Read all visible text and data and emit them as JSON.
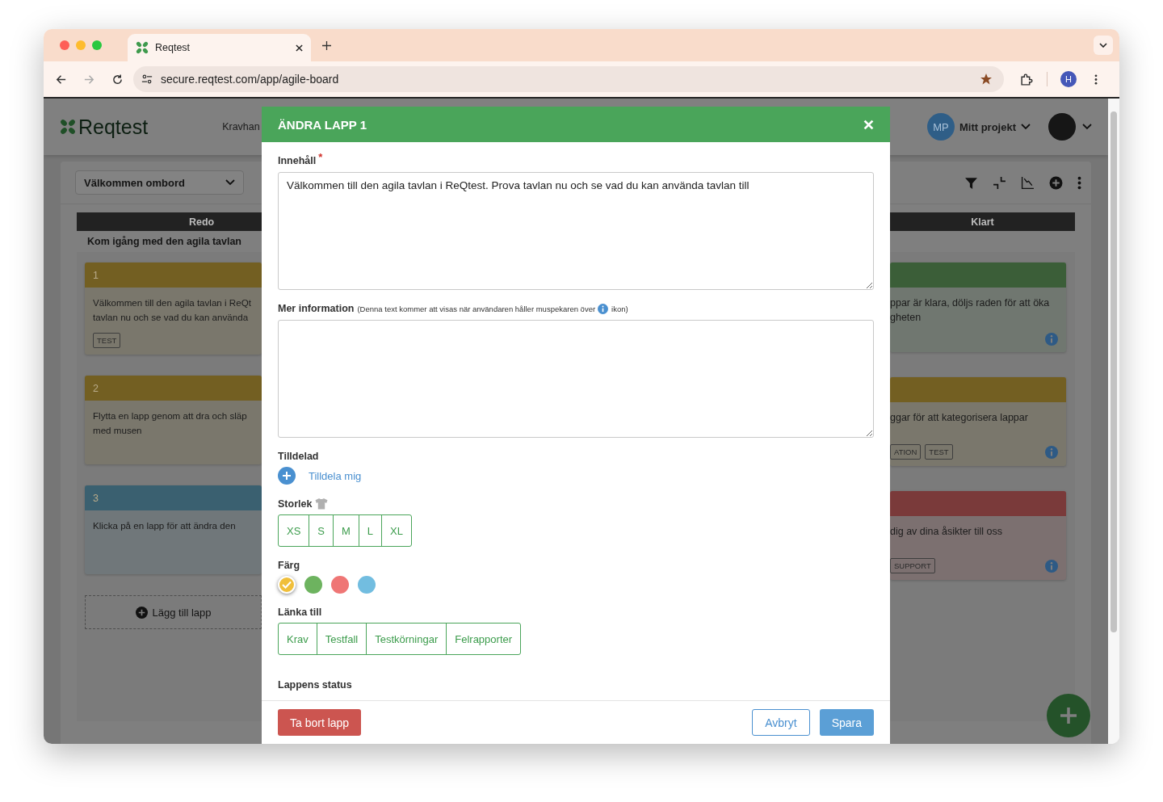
{
  "browser": {
    "tab_title": "Reqtest",
    "url": "secure.reqtest.com/app/agile-board",
    "profile_initial": "H"
  },
  "app": {
    "logo": "Reqtest",
    "nav_item": "Kravhan",
    "project": {
      "initials": "MP",
      "name": "Mitt projekt"
    }
  },
  "board": {
    "filter": "Välkommen ombord",
    "columns": [
      {
        "title": "Redo",
        "subtitle": "Kom igång med den agila tavlan",
        "add_label": "Lägg till lapp",
        "cards": [
          {
            "number": "1",
            "color": "#735f22",
            "lines": [
              "Välkommen till den agila tavlan i ReQt",
              "tavlan nu och se vad du kan använda"
            ],
            "tags": [
              "TEST"
            ],
            "info": false
          },
          {
            "number": "2",
            "color": "#735f22",
            "lines": [
              "Flytta en lapp genom att dra och släp",
              "med musen"
            ],
            "info": false
          },
          {
            "number": "3",
            "color": "#3a6070",
            "lines": [
              "Klicka på en lapp för att ändra den"
            ],
            "info": false
          }
        ]
      },
      {
        "title": "Klart",
        "cards": [
          {
            "color": "#3b5e38",
            "lines": [
              "ppar är klara, döljs raden för att öka",
              "gheten"
            ],
            "info": true
          },
          {
            "color": "#735f22",
            "lines": [
              "ggar för att kategorisera lappar"
            ],
            "tags": [
              "ATION",
              "TEST"
            ],
            "info": true
          },
          {
            "color": "#7a3a3a",
            "lines": [
              "dig av dina åsikter till oss"
            ],
            "tags": [
              "SUPPORT"
            ],
            "info": true
          }
        ]
      }
    ]
  },
  "modal": {
    "title": "ÄNDRA LAPP 1",
    "content_label": "Innehåll",
    "required_mark": "*",
    "content_value": "Välkommen till den agila tavlan i ReQtest. Prova tavlan nu och se vad du kan använda tavlan till",
    "more_label": "Mer information",
    "more_note_start": "(Denna text kommer att visas när användaren håller muspekaren över",
    "more_note_end": "ikon)",
    "assigned_label": "Tilldelad",
    "assign_link": "Tilldela mig",
    "size_label": "Storlek",
    "sizes": [
      {
        "label": "XS",
        "selected": false
      },
      {
        "label": "S",
        "selected": false
      },
      {
        "label": "M",
        "selected": false
      },
      {
        "label": "L",
        "selected": false
      },
      {
        "label": "XL",
        "selected": false
      }
    ],
    "color_label": "Färg",
    "colors": [
      {
        "color": "#f0bf3a",
        "selected": true
      },
      {
        "color": "#6db35f",
        "selected": false
      },
      {
        "color": "#ef7675",
        "selected": false
      },
      {
        "color": "#72bde0",
        "selected": false
      }
    ],
    "link_label": "Länka till",
    "links": [
      "Krav",
      "Testfall",
      "Testkörningar",
      "Felrapporter"
    ],
    "status_label": "Lappens status",
    "buttons": {
      "delete": "Ta bort lapp",
      "cancel": "Avbryt",
      "save": "Spara"
    }
  }
}
